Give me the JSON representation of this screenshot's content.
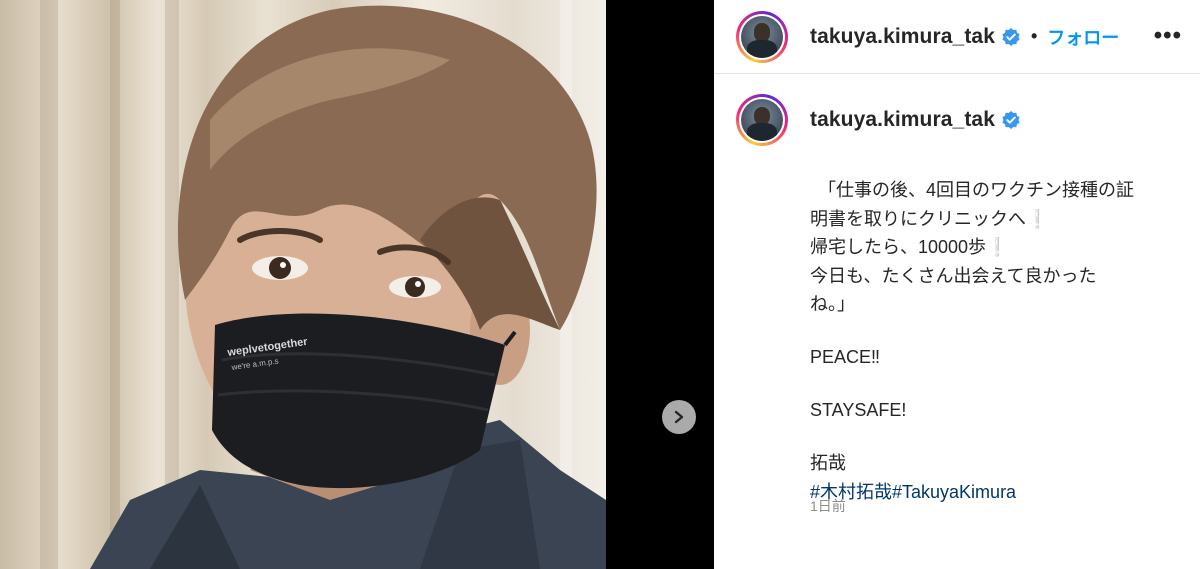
{
  "post": {
    "username": "takuya.kimura_tak",
    "follow_label": "フォロー",
    "separator": "•",
    "more_label": "•••",
    "caption_lines": [
      "「仕事の後、4回目のワクチン接種の証",
      "明書を取りにクリニックへ",
      "帰宅したら、10000歩",
      "今日も、たくさん出会えて良かった",
      "ね。」",
      "PEACE‼",
      "STAYSAFE!",
      "拓哉"
    ],
    "exclamation_glyph": "❕",
    "hashtags": "#木村拓哉#TakuyaKimura",
    "timestamp": "1日前",
    "mask_print_line1": "weplvetogether",
    "mask_print_line2": "we're a.m.p.s"
  },
  "colors": {
    "link_blue": "#0095f6",
    "hashtag_blue": "#00376b",
    "verified_blue": "#3897f0",
    "muted_gray": "#8e8e8e",
    "text_dark": "#262626"
  },
  "icons": {
    "verified": "verified-badge-icon",
    "next": "chevron-right-icon",
    "more": "more-options-icon"
  }
}
